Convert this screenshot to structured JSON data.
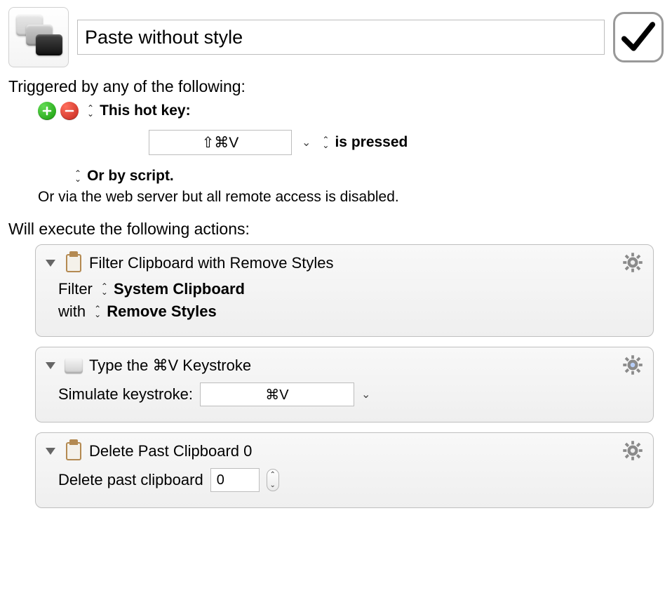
{
  "macro": {
    "title": "Paste without style",
    "enabled": true
  },
  "trigger": {
    "section_label": "Triggered by any of the following:",
    "type_label": "This hot key:",
    "hotkey": "⇧⌘V",
    "condition": "is pressed",
    "or_script": "Or by script.",
    "remote_note": "Or via the web server but all remote access is disabled."
  },
  "actions_label": "Will execute the following actions:",
  "actions": {
    "a1": {
      "title": "Filter Clipboard with Remove Styles",
      "filter_label": "Filter",
      "filter_value": "System Clipboard",
      "with_label": "with",
      "with_value": "Remove Styles"
    },
    "a2": {
      "title": "Type the ⌘V Keystroke",
      "sim_label": "Simulate keystroke:",
      "keystroke": "⌘V"
    },
    "a3": {
      "title": "Delete Past Clipboard 0",
      "del_label": "Delete past clipboard",
      "index": "0"
    }
  }
}
